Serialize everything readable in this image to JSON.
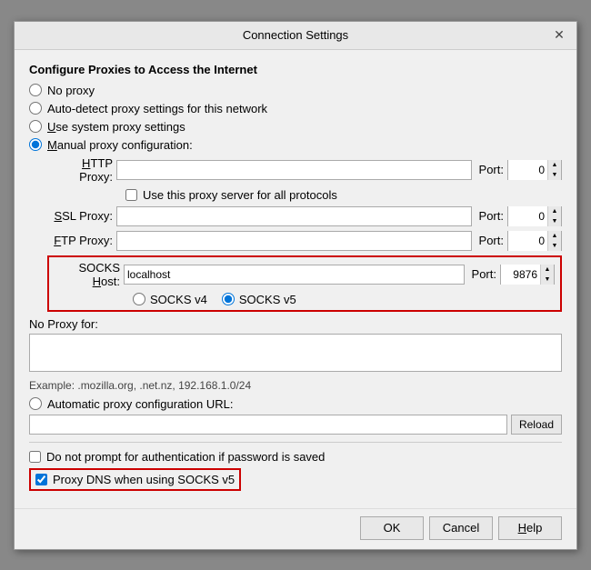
{
  "dialog": {
    "title": "Connection Settings",
    "close_label": "✕"
  },
  "section": {
    "configure_title": "Configure Proxies to Access the Internet"
  },
  "proxy_options": {
    "no_proxy": "No proxy",
    "auto_detect": "Auto-detect proxy settings for this network",
    "system_proxy": "Use system proxy settings",
    "manual_proxy": "Manual proxy configuration:"
  },
  "fields": {
    "http_proxy_label": "HTTP Proxy:",
    "http_proxy_value": "",
    "http_proxy_placeholder": "",
    "http_port": "0",
    "use_all_protocols": "Use this proxy server for all protocols",
    "ssl_proxy_label": "SSL Proxy:",
    "ssl_proxy_value": "",
    "ssl_port": "0",
    "ftp_proxy_label": "FTP Proxy:",
    "ftp_proxy_value": "",
    "ftp_port": "0",
    "socks_host_label": "SOCKS Host:",
    "socks_host_value": "localhost",
    "socks_port": "9876",
    "socks_v4_label": "SOCKS v4",
    "socks_v5_label": "SOCKS v5",
    "port_label": "Port:"
  },
  "no_proxy": {
    "label": "No Proxy for:",
    "value": ""
  },
  "example": {
    "text": "Example: .mozilla.org, .net.nz, 192.168.1.0/24"
  },
  "auto_proxy": {
    "label": "Automatic proxy configuration URL:",
    "value": "",
    "reload_label": "Reload"
  },
  "bottom": {
    "no_prompt": "Do not prompt for authentication if password is saved",
    "proxy_dns": "Proxy DNS when using SOCKS v5"
  },
  "buttons": {
    "ok": "OK",
    "cancel": "Cancel",
    "help": "Help"
  }
}
